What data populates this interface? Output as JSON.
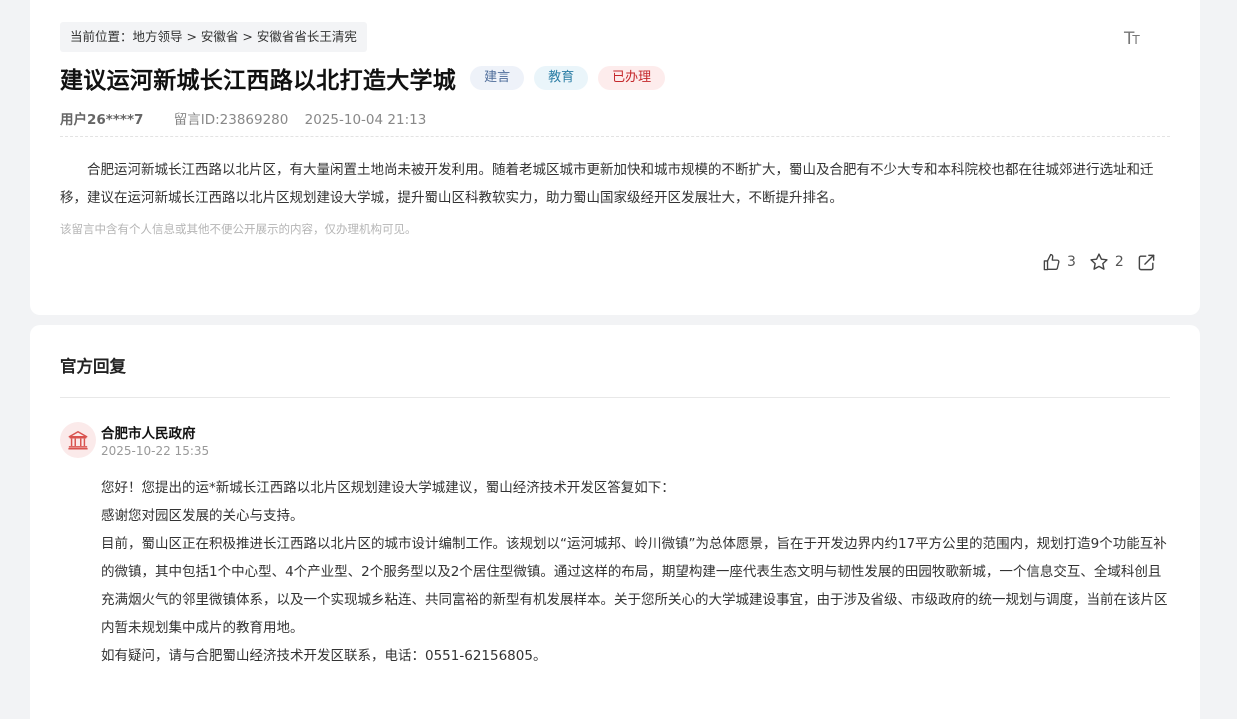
{
  "breadcrumb": {
    "text": "当前位置：地方领导 > 安徽省 > 安徽省省长王清宪"
  },
  "toolbar": {
    "font_size_icon": "font-size-icon"
  },
  "message": {
    "title": "建议运河新城长江西路以北打造大学城",
    "tags": [
      "建言",
      "教育",
      "已办理"
    ],
    "user": "用户26****7",
    "message_id": "留言ID:23869280",
    "datetime": "2025-10-04 21:13",
    "content": "合肥运河新城长江西路以北片区，有大量闲置土地尚未被开发利用。随着老城区城市更新加快和城市规模的不断扩大，蜀山及合肥有不少大专和本科院校也都在往城郊进行选址和迁移，建议在运河新城长江西路以北片区规划建设大学城，提升蜀山区科教软实力，助力蜀山国家级经开区发展壮大，不断提升排名。",
    "notice": "该留言中含有个人信息或其他不便公开展示的内容，仅办理机构可见。",
    "like_count": "3",
    "favorite_count": "2"
  },
  "reply": {
    "section_title": "官方回复",
    "org_name": "合肥市人民政府",
    "datetime": "2025-10-22 15:35",
    "paragraphs": [
      "您好！您提出的运*新城长江西路以北片区规划建设大学城建议，蜀山经济技术开发区答复如下：",
      "感谢您对园区发展的关心与支持。",
      "目前，蜀山区正在积极推进长江西路以北片区的城市设计编制工作。该规划以“运河城邦、岭川微镇”为总体愿景，旨在于开发边界内约17平方公里的范围内，规划打造9个功能互补的微镇，其中包括1个中心型、4个产业型、2个服务型以及2个居住型微镇。通过这样的布局，期望构建一座代表生态文明与韧性发展的田园牧歌新城，一个信息交互、全域科创且充满烟火气的邻里微镇体系，以及一个实现城乡粘连、共同富裕的新型有机发展样本。关于您所关心的大学城建设事宜，由于涉及省级、市级政府的统一规划与调度，当前在该片区内暂未规划集中成片的教育用地。",
      "如有疑问，请与合肥蜀山经济技术开发区联系，电话：0551-62156805。"
    ]
  },
  "colors": {
    "page_bg": "#f2f3f5",
    "tag_suggest": "#4f6d9a",
    "tag_education": "#2d7fa6",
    "tag_done": "#c5282c",
    "gov_icon": "#d9534f"
  },
  "icons": [
    "font-size-icon",
    "thumbs-up-icon",
    "star-icon",
    "share-icon",
    "government-building-icon"
  ]
}
